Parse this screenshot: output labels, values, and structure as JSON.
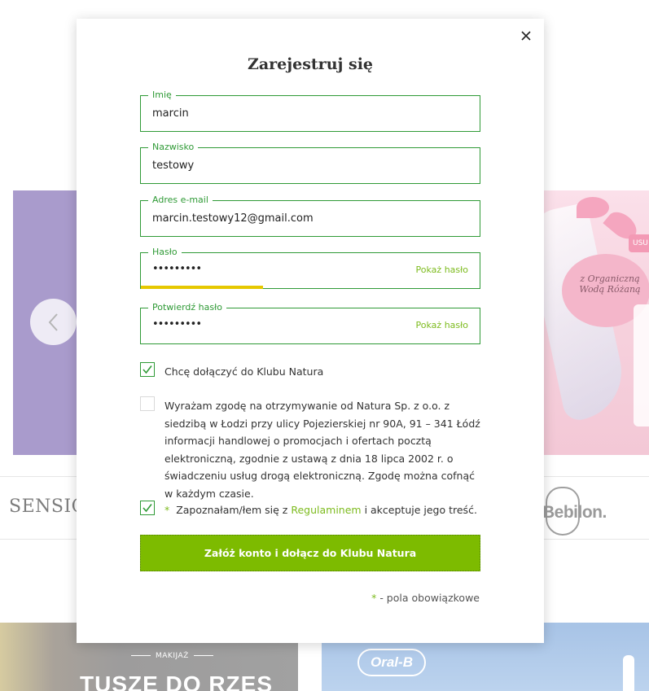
{
  "background": {
    "banner_right": {
      "badge": "USU",
      "text": "z Organiczną Wodą Różaną"
    },
    "brands": [
      "SENSIQU",
      "Bebilon."
    ],
    "tiles": [
      {
        "tag": "MAKIJAŻ",
        "heading": "TUSZE DO RZĘS"
      },
      {
        "brand": "Oral-B"
      }
    ]
  },
  "modal": {
    "title": "Zarejestruj się",
    "fields": {
      "first_name": {
        "label": "Imię",
        "value": "marcin"
      },
      "last_name": {
        "label": "Nazwisko",
        "value": "testowy"
      },
      "email": {
        "label": "Adres e-mail",
        "value": "marcin.testowy12@gmail.com"
      },
      "password": {
        "label": "Hasło",
        "masked": "•••••••••",
        "toggle": "Pokaż hasło",
        "strength_fraction": 0.36
      },
      "confirm": {
        "label": "Potwierdź hasło",
        "masked": "•••••••••",
        "toggle": "Pokaż hasło"
      }
    },
    "consents": {
      "club": {
        "checked": true,
        "text": "Chcę dołączyć do Klubu Natura"
      },
      "marketing": {
        "checked": false,
        "text": "Wyrażam zgodę na otrzymywanie od Natura Sp. z o.o. z siedzibą w Łodzi przy ulicy Pojezierskiej nr 90A, 91 – 341 Łódź informacji handlowej o promocjach i ofertach pocztą elektroniczną, zgodnie z ustawą z dnia 18 lipca 2002 r. o świadczeniu usług drogą elektroniczną. Zgodę można cofnąć w każdym czasie."
      },
      "terms": {
        "checked": true,
        "star": "*",
        "before": "Zapoznałam/łem się z",
        "link": "Regulaminem",
        "after": "i akceptuje jego treść."
      }
    },
    "submit_label": "Załóż konto i dołącz do Klubu Natura",
    "required_note": {
      "star": "*",
      "text": "- pola obowiązkowe"
    }
  },
  "colors": {
    "accent_green": "#7dbb00",
    "border_green": "#2f9a36",
    "strength_yellow": "#e6c800"
  },
  "icons": {
    "close": "close-icon",
    "check": "check-icon",
    "prev": "chevron-left-icon"
  }
}
